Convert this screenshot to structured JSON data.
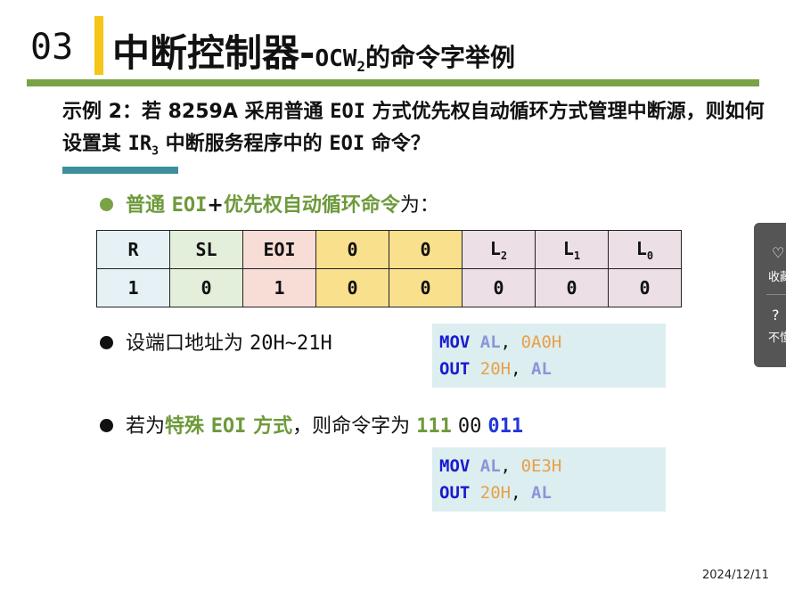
{
  "header": {
    "section_number": "03",
    "title_main": "中断控制器-",
    "title_sub": "OCW",
    "title_sub_index": "2",
    "title_tail": "的命令字举例"
  },
  "question": {
    "p1": "示例 2：若 8259A 采用普通 ",
    "p1_code": "EOI",
    "p2": " 方式优先权自动循环方式管理中断源，则如何设置其 ",
    "ir": "IR",
    "ir_index": "3",
    "p3": " 中断服务程序中的 ",
    "p3_code": "EOI",
    "p4": " 命令？"
  },
  "bullet1": {
    "dot_color": "#7aa246",
    "green_a": "普通 ",
    "green_code": "EOI",
    "plus": "+",
    "green_b": "优先权自动循环命令",
    "suffix": "为："
  },
  "table": {
    "header": [
      {
        "text": "R",
        "sub": "",
        "bg": "#e6f1f5"
      },
      {
        "text": "SL",
        "sub": "",
        "bg": "#e3efda"
      },
      {
        "text": "EOI",
        "sub": "",
        "bg": "#f8ddd6"
      },
      {
        "text": "0",
        "sub": "",
        "bg": "#f9e08d"
      },
      {
        "text": "0",
        "sub": "",
        "bg": "#f9e08d"
      },
      {
        "text": "L",
        "sub": "2",
        "bg": "#ecdfe6"
      },
      {
        "text": "L",
        "sub": "1",
        "bg": "#ecdfe6"
      },
      {
        "text": "L",
        "sub": "0",
        "bg": "#ecdfe6"
      }
    ],
    "values": [
      "1",
      "0",
      "1",
      "0",
      "0",
      "0",
      "0",
      "0"
    ]
  },
  "bullet2": {
    "dot_color": "#111111",
    "text": "设端口地址为 ",
    "addr": "20H~21H"
  },
  "code1": {
    "line1": {
      "op": "MOV",
      "reg": "AL",
      "comma": ",",
      "val": "0A0H"
    },
    "line2": {
      "op": "OUT",
      "val": "20H",
      "comma": ",",
      "reg": "AL"
    }
  },
  "bullet3": {
    "dot_color": "#111111",
    "prefix": "若为",
    "green_a": "特殊 ",
    "green_code": "EOI",
    "green_b": " 方式",
    "mid": "，则命令字为 ",
    "bits1": "111",
    "bits2": "00",
    "bits3": "011"
  },
  "code2": {
    "line1": {
      "op": "MOV",
      "reg": "AL",
      "comma": ",",
      "val": "0E3H"
    },
    "line2": {
      "op": "OUT",
      "val": "20H",
      "comma": ",",
      "reg": "AL"
    }
  },
  "side_panel": {
    "fav_icon": "heart-icon",
    "fav_label": "收藏",
    "help_icon": "question-circle-icon",
    "help_label": "不懂"
  },
  "date": "2024/12/11"
}
